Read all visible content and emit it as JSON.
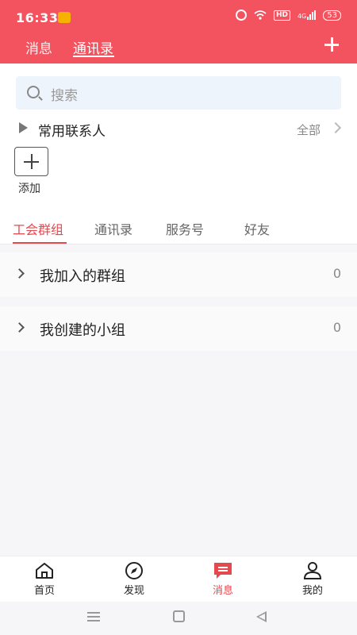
{
  "status_bar": {
    "time": "16:33",
    "network": "4G",
    "hd_label": "HD",
    "battery": "53"
  },
  "header": {
    "tabs": [
      {
        "label": "消息"
      },
      {
        "label": "通讯录"
      }
    ],
    "active_tab": "通讯录"
  },
  "search": {
    "placeholder": "搜索"
  },
  "favorites": {
    "label": "常用联系人",
    "all_label": "全部",
    "add_label": "添加"
  },
  "segment_tabs": [
    {
      "label": "工会群组"
    },
    {
      "label": "通讯录"
    },
    {
      "label": "服务号"
    },
    {
      "label": "好友"
    }
  ],
  "active_segment": "工会群组",
  "groups": [
    {
      "label": "我加入的群组",
      "count": "0"
    },
    {
      "label": "我创建的小组",
      "count": "0"
    }
  ],
  "bottom_nav": [
    {
      "label": "首页",
      "icon": "home-icon"
    },
    {
      "label": "发现",
      "icon": "compass-icon"
    },
    {
      "label": "消息",
      "icon": "message-icon"
    },
    {
      "label": "我的",
      "icon": "user-icon"
    }
  ],
  "active_nav": "消息",
  "colors": {
    "brand": "#f2535e",
    "accent": "#e5484d",
    "background": "#f6f6f8"
  }
}
